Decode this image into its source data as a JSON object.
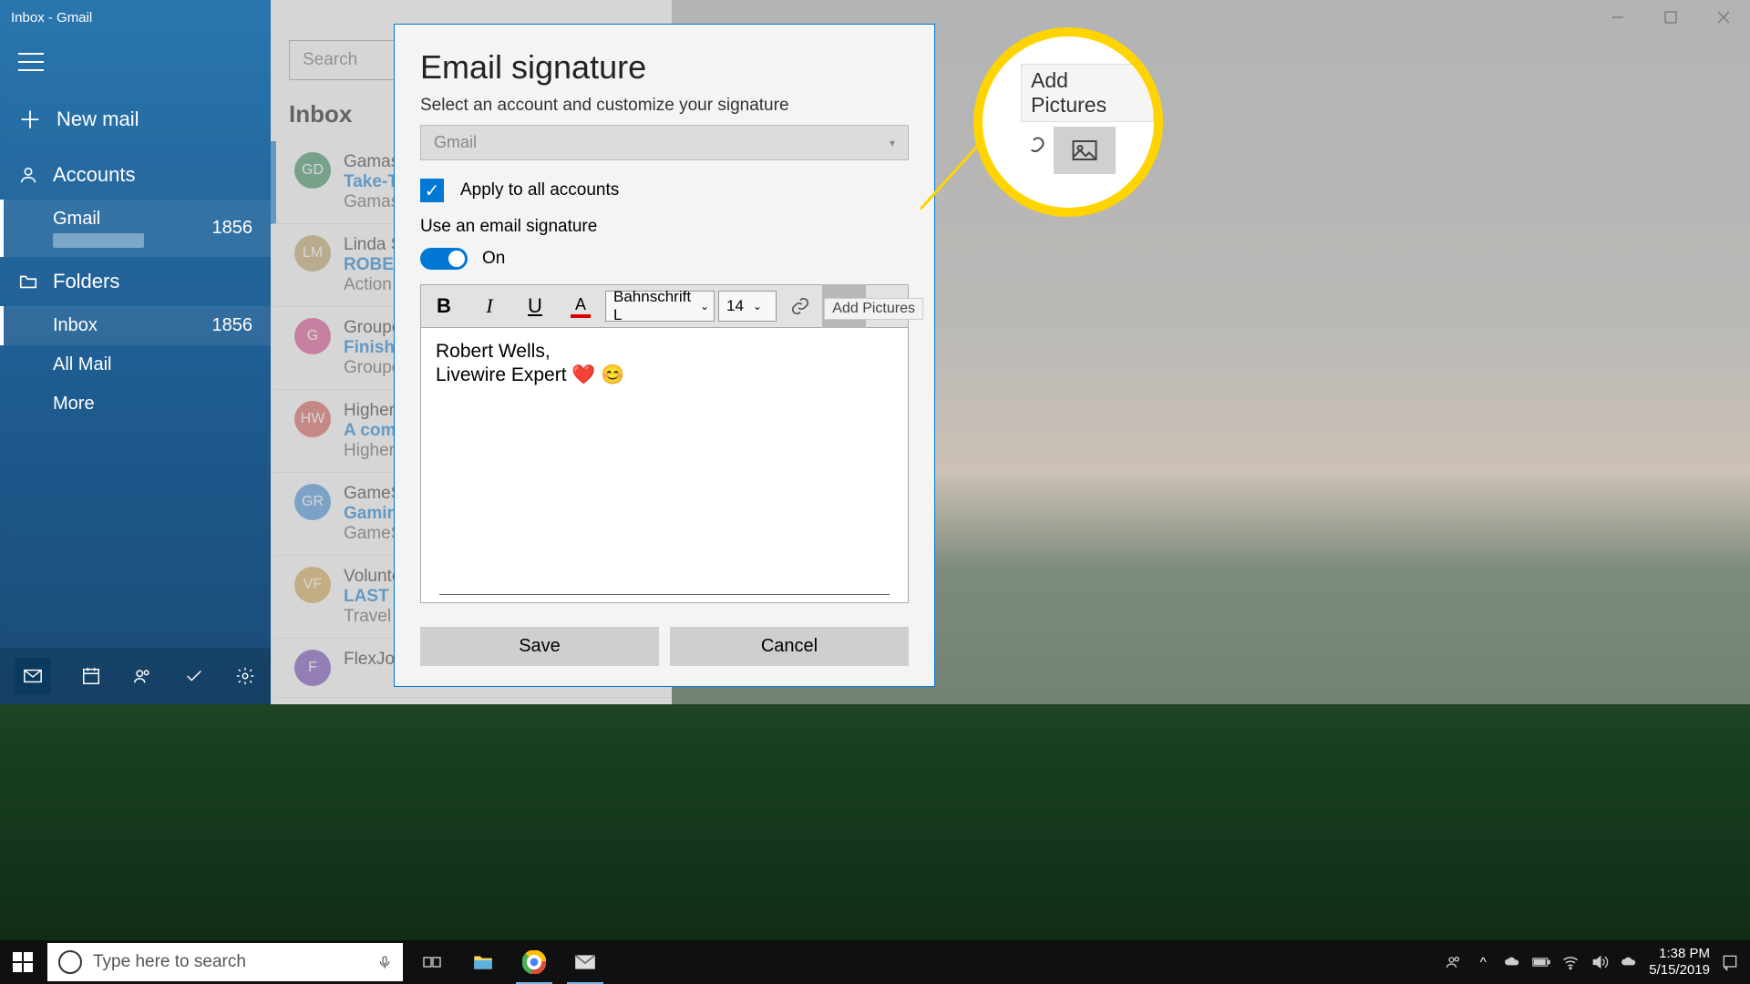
{
  "titlebar": {
    "title": "Inbox - Gmail"
  },
  "sidebar": {
    "new_mail": "New mail",
    "accounts": "Accounts",
    "gmail_label": "Gmail",
    "gmail_count": "1856",
    "folders": "Folders",
    "inbox": "Inbox",
    "inbox_count": "1856",
    "all_mail": "All Mail",
    "more": "More"
  },
  "maillist": {
    "search_placeholder": "Search",
    "header": "Inbox",
    "messages": [
      {
        "initials": "GD",
        "color": "#2e8b57",
        "from": "Gamasut",
        "subject": "Take-Two",
        "preview": "Gamasut"
      },
      {
        "initials": "LM",
        "color": "#bfa060",
        "from": "Linda Sa",
        "subject": "ROBERT,",
        "preview": "Action N"
      },
      {
        "initials": "G",
        "color": "#e0428a",
        "from": "Groupon",
        "subject": "Finish Lin",
        "preview": "Groupon"
      },
      {
        "initials": "HW",
        "color": "#d9534f",
        "from": "Higher E",
        "subject": "A compe",
        "preview": "Higher E"
      },
      {
        "initials": "GR",
        "color": "#3a8dde",
        "from": "GameSto",
        "subject": "Gaming",
        "preview": "GameSto"
      },
      {
        "initials": "VF",
        "color": "#d4a548",
        "from": "Voluntee",
        "subject": "LAST Tra",
        "preview": "Travel to"
      },
      {
        "initials": "F",
        "color": "#6b3fb5",
        "from": "FlexJobs",
        "subject": "",
        "preview": ""
      }
    ]
  },
  "dialog": {
    "title": "Email signature",
    "subtitle": "Select an account and customize your signature",
    "account_value": "Gmail",
    "apply_all_label": "Apply to all accounts",
    "use_sig_label": "Use an email signature",
    "toggle_label": "On",
    "font_name": "Bahnschrift L",
    "font_size": "14",
    "tooltip": "Add Pictures",
    "editor_line1": "Robert Wells,",
    "editor_line2": "Livewire Expert ❤️ 😊",
    "save": "Save",
    "cancel": "Cancel"
  },
  "callout": {
    "tooltip": "Add Pictures"
  },
  "taskbar": {
    "search_placeholder": "Type here to search",
    "time": "1:38 PM",
    "date": "5/15/2019"
  }
}
